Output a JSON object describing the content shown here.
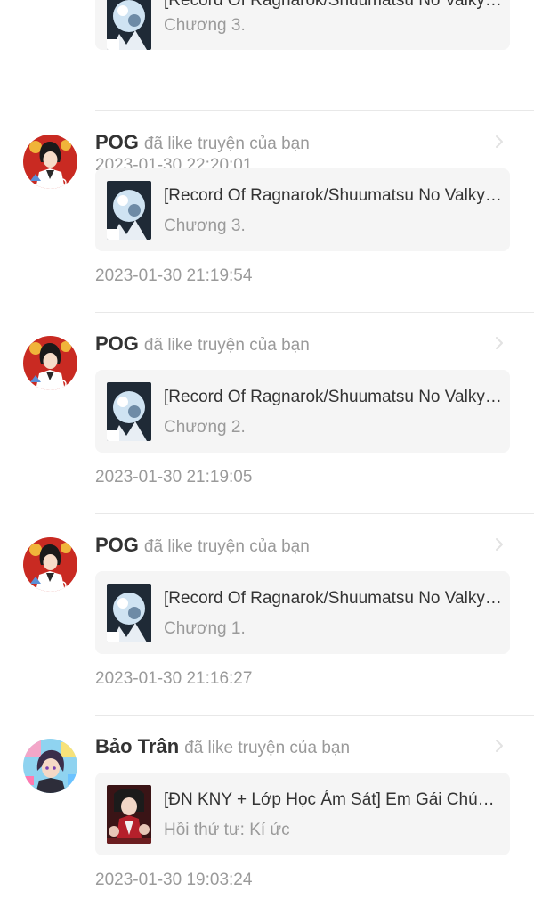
{
  "partial_top": {
    "story_title": "[Record Of Ragnarok/Shuumatsu No Valkyrie]",
    "story_chapter": "Chương 3.",
    "time": "2023-01-30 22:20:01"
  },
  "notifications": [
    {
      "user": "POG",
      "action": "đã like truyện của bạn",
      "story_title": "[Record Of Ragnarok/Shuumatsu No Valkyrie]",
      "story_chapter": "Chương 3.",
      "time": "2023-01-30 21:19:54",
      "avatar": "avatar-pog",
      "cover": "cover-ragnarok"
    },
    {
      "user": "POG",
      "action": "đã like truyện của bạn",
      "story_title": "[Record Of Ragnarok/Shuumatsu No Valkyrie]",
      "story_chapter": "Chương 2.",
      "time": "2023-01-30 21:19:05",
      "avatar": "avatar-pog",
      "cover": "cover-ragnarok"
    },
    {
      "user": "POG",
      "action": "đã like truyện của bạn",
      "story_title": "[Record Of Ragnarok/Shuumatsu No Valkyrie]",
      "story_chapter": "Chương 1.",
      "time": "2023-01-30 21:16:27",
      "avatar": "avatar-pog",
      "cover": "cover-ragnarok"
    },
    {
      "user": "Bảo Trân",
      "action": "đã like truyện của bạn",
      "story_title": "[ĐN KNY + Lớp Học Ám Sát] Em Gái Chúa Quỷ",
      "story_chapter": "Hồi thứ tư: Kí ức",
      "time": "2023-01-30 19:03:24",
      "avatar": "avatar-bao-tran",
      "cover": "cover-kny"
    }
  ],
  "colors": {
    "background": "#ffffff",
    "card": "#f5f5f5",
    "name_text": "#333333",
    "secondary_text": "#9a9a9a",
    "divider": "#e8e8e8"
  }
}
